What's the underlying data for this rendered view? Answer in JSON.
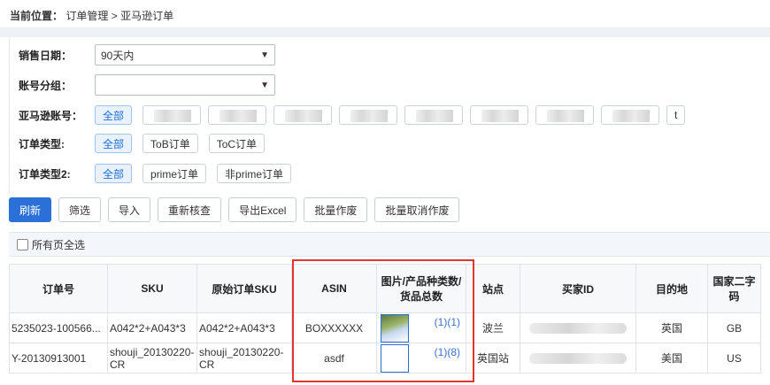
{
  "breadcrumb": {
    "lead": "当前位置：",
    "items": [
      "订单管理",
      "亚马逊订单"
    ],
    "sep": ">"
  },
  "filters": {
    "sale_date": {
      "label": "销售日期：",
      "value": "90天内"
    },
    "account_group": {
      "label": "账号分组：",
      "value": ""
    },
    "amazon_account": {
      "label": "亚马逊账号：",
      "all": "全部",
      "tail": "t"
    },
    "order_type": {
      "label": "订单类型:",
      "options": [
        "全部",
        "ToB订单",
        "ToC订单"
      ]
    },
    "order_type2": {
      "label": "订单类型2:",
      "options": [
        "全部",
        "prime订单",
        "非prime订单"
      ]
    }
  },
  "toolbar": [
    "刷新",
    "筛选",
    "导入",
    "重新核查",
    "导出Excel",
    "批量作废",
    "批量取消作废"
  ],
  "select_all_label": "所有页全选",
  "table": {
    "headers": [
      "订单号",
      "SKU",
      "原始订单SKU",
      "ASIN",
      "图片/产品种类数/货品总数",
      "站点",
      "买家ID",
      "目的地",
      "国家二字码"
    ],
    "rows": [
      {
        "order_no": "5235023-100566...",
        "sku": "A042*2+A043*3",
        "orig_sku": "A042*2+A043*3",
        "asin": "BOXXXXXX",
        "counts": "(1)(1)",
        "site": "波兰",
        "dest": "英国",
        "code": "GB"
      },
      {
        "order_no": "Y-20130913001",
        "sku": "shouji_20130220-CR",
        "orig_sku": "shouji_20130220-CR",
        "asin": "asdf",
        "counts": "(1)(8)",
        "site": "英国站",
        "dest": "美国",
        "code": "US"
      }
    ]
  }
}
